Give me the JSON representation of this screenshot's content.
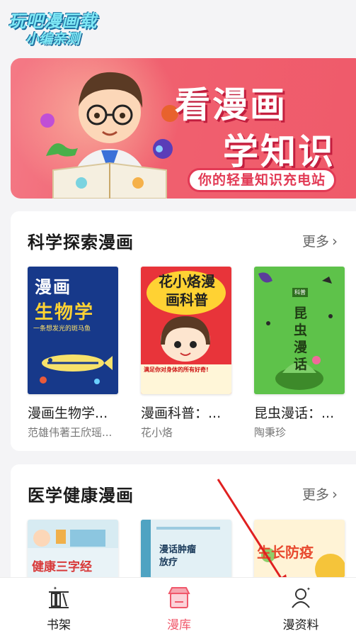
{
  "logo": {
    "line1": "玩吧漫画载",
    "line2": "小编亲测"
  },
  "banner": {
    "title_line1": "看漫画",
    "title_line2": "学知识",
    "subtitle": "你的轻量知识充电站"
  },
  "sections": [
    {
      "title": "科学探索漫画",
      "more_label": "更多",
      "books": [
        {
          "title": "漫画生物学...",
          "author": "范雄伟著王欣瑶...",
          "cover_text": "漫画",
          "cover_text2": "生物学",
          "cover_sub": "一条想发光的斑马鱼"
        },
        {
          "title": "漫画科普：...",
          "author": "花小烙",
          "cover_text": "花小烙漫画科普",
          "cover_sub": "满足你对身体的所有好奇!"
        },
        {
          "title": "昆虫漫话：...",
          "author": "陶秉珍",
          "cover_text": "昆虫漫话"
        }
      ]
    },
    {
      "title": "医学健康漫画",
      "more_label": "更多",
      "books": [
        {
          "cover_text": "健康三字经"
        },
        {
          "cover_text": "漫话肿瘤放疗"
        },
        {
          "cover_text": "生长防疫"
        }
      ]
    }
  ],
  "tabbar": {
    "items": [
      {
        "label": "书架",
        "icon": "bookshelf-icon"
      },
      {
        "label": "漫库",
        "icon": "store-icon",
        "active": true
      },
      {
        "label": "漫资料",
        "icon": "profile-icon"
      }
    ]
  },
  "colors": {
    "accent": "#f0586b",
    "annotation": "#e02020"
  }
}
